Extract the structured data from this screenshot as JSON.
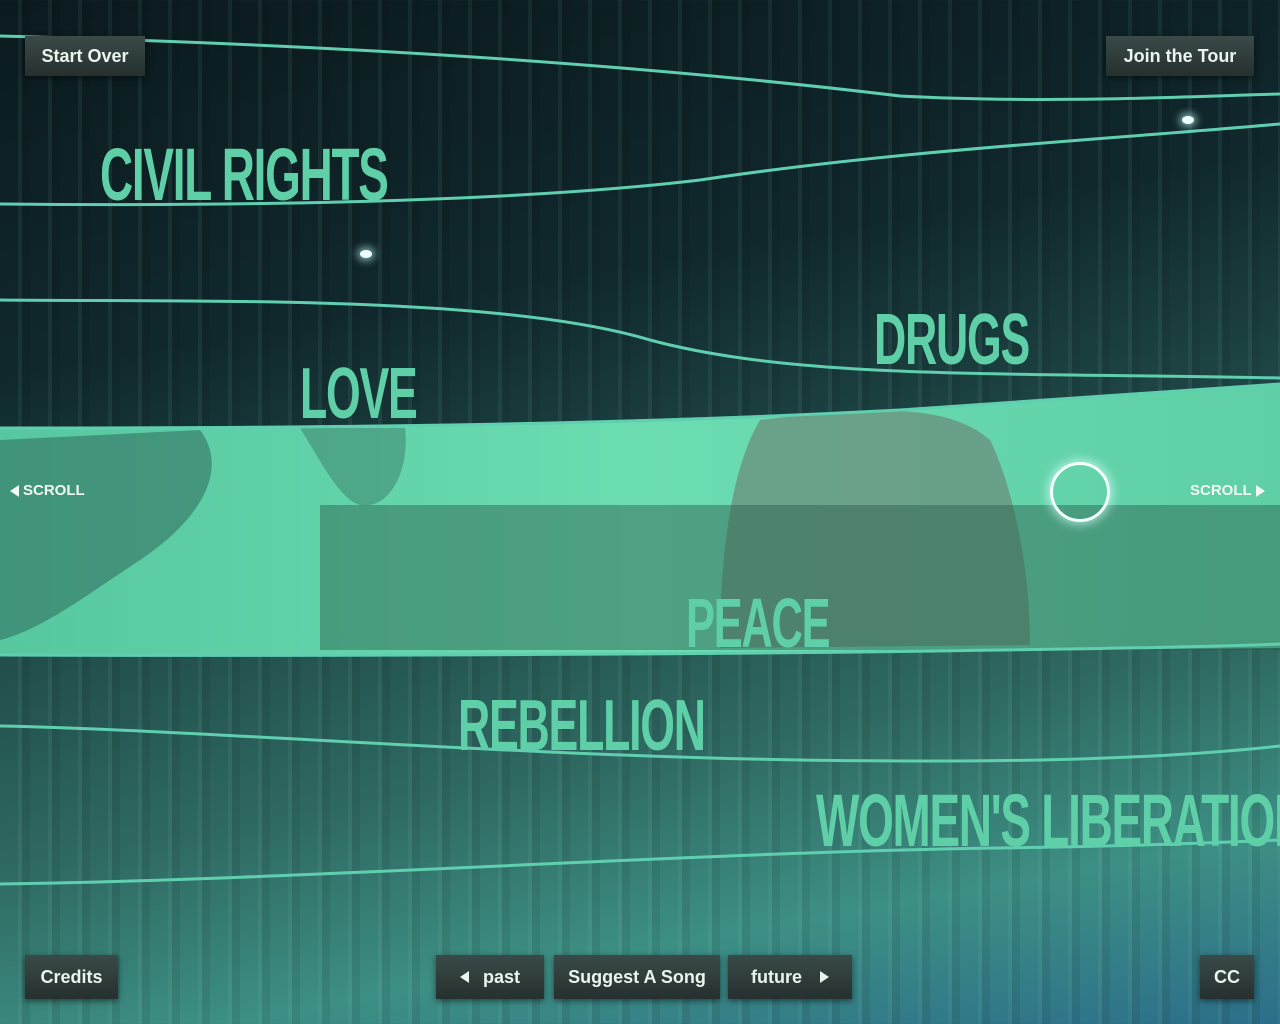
{
  "header": {
    "start_over": "Start Over",
    "join_tour": "Join the Tour"
  },
  "topics": {
    "civil_rights": "CIVIL RIGHTS",
    "drugs": "DRUGS",
    "love": "LOVE",
    "peace": "PEACE",
    "rebellion": "REBELLION",
    "womens_liberation": "WOMEN'S LIBERATION"
  },
  "scroll": {
    "left": "SCROLL",
    "right": "SCROLL"
  },
  "footer": {
    "credits": "Credits",
    "past": "past",
    "suggest": "Suggest A Song",
    "future": "future",
    "cc": "CC"
  },
  "colors": {
    "accent": "#5fcfa8",
    "band": "#66d8ad",
    "button_bg": "#2f3b3a",
    "button_text": "#e9f4ef"
  }
}
